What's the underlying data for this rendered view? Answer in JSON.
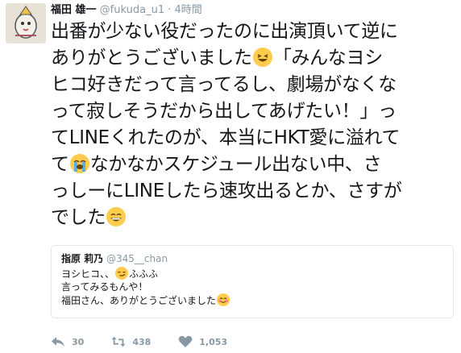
{
  "tweet": {
    "author": {
      "display_name": "福田 雄一",
      "handle": "@fukuda_u1",
      "separator": "·",
      "timestamp": "4時間"
    },
    "text_lines": [
      "出番が少ない役だったのに出演頂いて逆に",
      "ありがとうございました",
      "「みんなヨシ",
      "ヒコ好きだって言ってるし、劇場がなくな",
      "って寂しそうだから出してあげたい！」っ",
      "てLINEくれたのが、本当にHKT愛に溢れて",
      "て",
      "なかなかスケジュール出ない中、さ",
      "っしーにLINEしたら速攻出るとか、さすが",
      "でした"
    ],
    "emojis": {
      "laughing": "grinning-squinting-face-icon",
      "crying": "loudly-crying-face-icon",
      "grin": "grinning-face-icon",
      "smirk": "smirking-face-icon",
      "smile": "smiling-face-icon"
    }
  },
  "quote": {
    "display_name": "指原 莉乃",
    "handle": "@345__chan",
    "lines": [
      "ヨシヒコ、、",
      "ふふふ",
      "言ってみるもんや！",
      "福田さん、ありがとうございました"
    ]
  },
  "actions": {
    "reply_count": "30",
    "retweet_count": "438",
    "like_count": "1,053"
  },
  "colors": {
    "muted": "#8899a6",
    "text": "#14171a",
    "border": "#e1e8ed",
    "emoji_yellow": "#ffcc4d"
  }
}
